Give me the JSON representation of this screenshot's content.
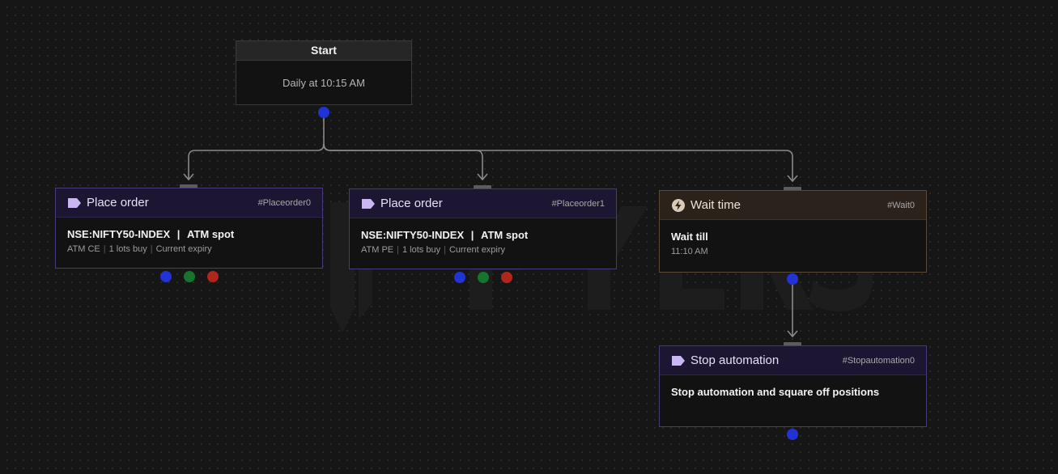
{
  "start": {
    "title": "Start",
    "schedule": "Daily at 10:15 AM"
  },
  "nodes": [
    {
      "title": "Place order",
      "tag": "#Placeorder0",
      "instrument": "NSE:NIFTY50-INDEX",
      "strike_ref": "ATM spot",
      "option": "ATM CE",
      "lots": "1 lots buy",
      "expiry": "Current expiry"
    },
    {
      "title": "Place order",
      "tag": "#Placeorder1",
      "instrument": "NSE:NIFTY50-INDEX",
      "strike_ref": "ATM spot",
      "option": "ATM PE",
      "lots": "1 lots buy",
      "expiry": "Current expiry"
    }
  ],
  "wait": {
    "title": "Wait time",
    "tag": "#Wait0",
    "label": "Wait till",
    "time": "11:10 AM",
    "icon": "lightning-icon"
  },
  "stop": {
    "title": "Stop automation",
    "tag": "#Stopautomation0",
    "description": "Stop automation and square off positions",
    "icon": "tag-icon"
  },
  "colors": {
    "port_blue": "#2233d6",
    "port_green": "#15752f",
    "port_red": "#b0251d",
    "node_purple": "#1d1633",
    "node_amber": "#2a221b"
  }
}
